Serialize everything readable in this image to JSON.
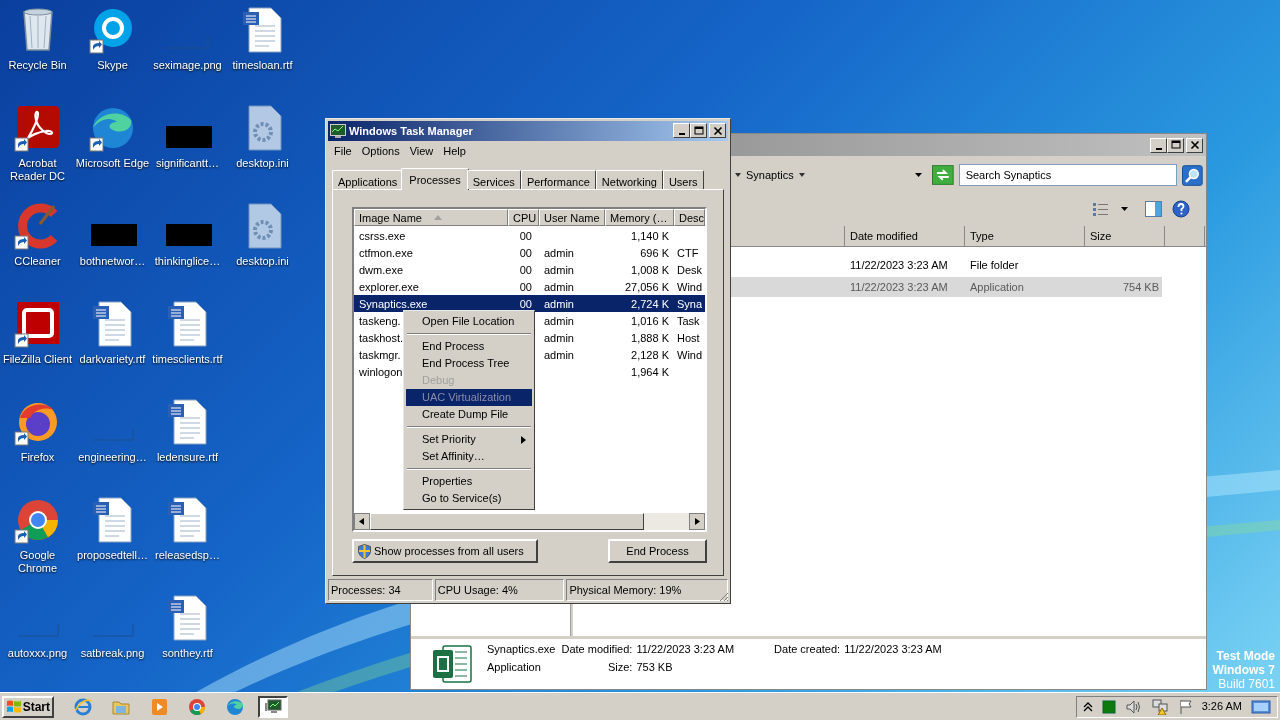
{
  "desktop": {
    "icons": [
      {
        "label": "Recycle Bin",
        "kind": "trash",
        "shortcut": false
      },
      {
        "label": "Acrobat Reader DC",
        "kind": "acrobat",
        "shortcut": true
      },
      {
        "label": "CCleaner",
        "kind": "ccleaner",
        "shortcut": true
      },
      {
        "label": "FileZilla Client",
        "kind": "filezilla",
        "shortcut": true
      },
      {
        "label": "Firefox",
        "kind": "firefox",
        "shortcut": true
      },
      {
        "label": "Google Chrome",
        "kind": "chrome",
        "shortcut": true
      },
      {
        "label": "autoxxx.png",
        "kind": "image",
        "shortcut": false
      },
      {
        "label": "Skype",
        "kind": "skype",
        "shortcut": true
      },
      {
        "label": "Microsoft Edge",
        "kind": "edge",
        "shortcut": true
      },
      {
        "label": "bothnetwor…",
        "kind": "dark-image",
        "shortcut": false
      },
      {
        "label": "darkvariety.rtf",
        "kind": "word",
        "shortcut": false
      },
      {
        "label": "engineering…",
        "kind": "image",
        "shortcut": false
      },
      {
        "label": "proposedtell…",
        "kind": "word",
        "shortcut": false
      },
      {
        "label": "satbreak.png",
        "kind": "image",
        "shortcut": false
      },
      {
        "label": "seximage.png",
        "kind": "image",
        "shortcut": false
      },
      {
        "label": "significantt…",
        "kind": "dark-image",
        "shortcut": false
      },
      {
        "label": "thinkinglice…",
        "kind": "dark-image",
        "shortcut": false
      },
      {
        "label": "timesclients.rtf",
        "kind": "word",
        "shortcut": false
      },
      {
        "label": "ledensure.rtf",
        "kind": "word",
        "shortcut": false
      },
      {
        "label": "releasedsp…",
        "kind": "word",
        "shortcut": false
      },
      {
        "label": "sonthey.rtf",
        "kind": "word",
        "shortcut": false
      },
      {
        "label": "timesloan.rtf",
        "kind": "word",
        "shortcut": false
      },
      {
        "label": "desktop.ini",
        "kind": "ini",
        "shortcut": false
      },
      {
        "label": "desktop.ini",
        "kind": "ini",
        "shortcut": false
      }
    ],
    "edition": [
      "Test Mode",
      "Windows 7",
      "Build 7601"
    ]
  },
  "explorer": {
    "breadcrumb": "Synaptics",
    "search": {
      "placeholder": "Search Synaptics"
    },
    "columns": [
      "Date modified",
      "Type",
      "Size"
    ],
    "rows": [
      {
        "date": "11/22/2023 3:23 AM",
        "type": "File folder",
        "selected": false
      },
      {
        "date": "11/22/2023 3:23 AM",
        "type": "Application",
        "size": "754 KB",
        "selected": true
      }
    ],
    "details": {
      "name": "Synaptics.exe",
      "type": "Application",
      "modified_label": "Date modified:",
      "modified": "11/22/2023 3:23 AM",
      "created_label": "Date created:",
      "created": "11/22/2023 3:23 AM",
      "size_label": "Size:",
      "size": "753 KB"
    }
  },
  "task_manager": {
    "title": "Windows Task Manager",
    "menu": [
      "File",
      "Options",
      "View",
      "Help"
    ],
    "tabs": [
      {
        "label": "Applications",
        "selected": false
      },
      {
        "label": "Processes",
        "selected": true
      },
      {
        "label": "Services",
        "selected": false
      },
      {
        "label": "Performance",
        "selected": false
      },
      {
        "label": "Networking",
        "selected": false
      },
      {
        "label": "Users",
        "selected": false
      }
    ],
    "columns": [
      "Image Name",
      "CPU",
      "User Name",
      "Memory (…",
      "Desc"
    ],
    "rows": [
      {
        "image": "csrss.exe",
        "cpu": "00",
        "memory": "1,140 K",
        "selected": false
      },
      {
        "image": "ctfmon.exe",
        "cpu": "00",
        "user": "admin",
        "memory": "696 K",
        "desc": "CTF",
        "selected": false
      },
      {
        "image": "dwm.exe",
        "cpu": "00",
        "user": "admin",
        "memory": "1,008 K",
        "desc": "Desk",
        "selected": false
      },
      {
        "image": "explorer.exe",
        "cpu": "00",
        "user": "admin",
        "memory": "27,056 K",
        "desc": "Wind",
        "selected": false
      },
      {
        "image": "Synaptics.exe",
        "cpu": "00",
        "user": "admin",
        "memory": "2,724 K",
        "desc": "Syna",
        "selected": true
      },
      {
        "image": "taskeng.",
        "user": "admin",
        "memory": "1,016 K",
        "desc": "Task",
        "selected": false
      },
      {
        "image": "taskhost.",
        "user": "admin",
        "memory": "1,888 K",
        "desc": "Host",
        "selected": false
      },
      {
        "image": "taskmgr.",
        "user": "admin",
        "memory": "2,128 K",
        "desc": "Wind",
        "selected": false
      },
      {
        "image": "winlogon",
        "memory": "1,964 K",
        "selected": false
      }
    ],
    "show_all_button": "Show processes from all users",
    "end_button": "End Process",
    "status": [
      "Processes: 34",
      "CPU Usage: 4%",
      "Physical Memory: 19%"
    ],
    "context_menu": [
      [
        {
          "label": "Open File Location",
          "disabled": false,
          "selected": false,
          "submenu": false
        }
      ],
      [
        {
          "label": "End Process",
          "disabled": false,
          "selected": false,
          "submenu": false
        },
        {
          "label": "End Process Tree",
          "disabled": false,
          "selected": false,
          "submenu": false
        },
        {
          "label": "Debug",
          "disabled": true,
          "selected": false,
          "submenu": false
        },
        {
          "label": "UAC Virtualization",
          "disabled": true,
          "selected": true,
          "submenu": false
        },
        {
          "label": "Create Dump File",
          "disabled": false,
          "selected": false,
          "submenu": false
        }
      ],
      [
        {
          "label": "Set Priority",
          "disabled": false,
          "selected": false,
          "submenu": true
        },
        {
          "label": "Set Affinity…",
          "disabled": false,
          "selected": false,
          "submenu": false
        }
      ],
      [
        {
          "label": "Properties",
          "disabled": false,
          "selected": false,
          "submenu": false
        },
        {
          "label": "Go to Service(s)",
          "disabled": false,
          "selected": false,
          "submenu": false
        }
      ]
    ]
  },
  "taskbar": {
    "start": "Start",
    "buttons": [
      {
        "kind": "ie",
        "selected": false
      },
      {
        "kind": "folder",
        "selected": false
      },
      {
        "kind": "media",
        "selected": false
      },
      {
        "kind": "chrome",
        "selected": false
      },
      {
        "kind": "edge",
        "selected": false
      },
      {
        "kind": "taskmgr",
        "selected": true
      }
    ],
    "clock": "3:26 AM"
  }
}
